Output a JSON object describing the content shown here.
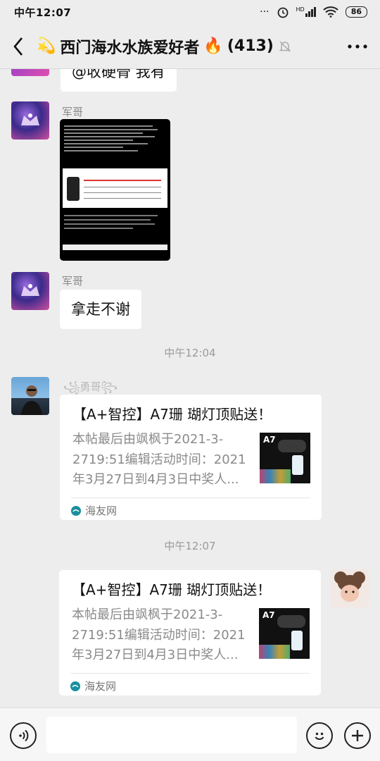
{
  "status_bar": {
    "time": "中午12:07",
    "network": "HD",
    "battery": "86"
  },
  "header": {
    "title_prefix_emoji": "💫",
    "title": "西门海水水族爱好者",
    "title_suffix_emoji": "🔥",
    "member_count": "(413)"
  },
  "messages": {
    "top_partial_text": "@收硬骨 我有",
    "msg1": {
      "sender": "军哥"
    },
    "msg2": {
      "sender": "军哥",
      "text": "拿走不谢"
    },
    "timestamp1": "中午12:04",
    "msg3": {
      "sender": "勇哥",
      "card": {
        "title": "【A+智控】A7珊 瑚灯顶贴送！",
        "desc_lines": [
          "本帖最后由飒枫于2021-3-",
          "2719:51编辑活动时间：2021",
          "年3月27日到4月3日中奖人..."
        ],
        "source": "海友网",
        "thumb_label": "A7"
      }
    },
    "timestamp2": "中午12:07",
    "msg4": {
      "card": {
        "title": "【A+智控】A7珊 瑚灯顶贴送！",
        "desc_lines": [
          "本帖最后由飒枫于2021-3-",
          "2719:51编辑活动时间：2021",
          "年3月27日到4月3日中奖人..."
        ],
        "source": "海友网",
        "thumb_label": "A7"
      }
    }
  },
  "colors": {
    "background": "#ededed",
    "bubble": "#ffffff",
    "secondary_text": "#8a8a8a",
    "source_icon": "#1a8fa0"
  }
}
